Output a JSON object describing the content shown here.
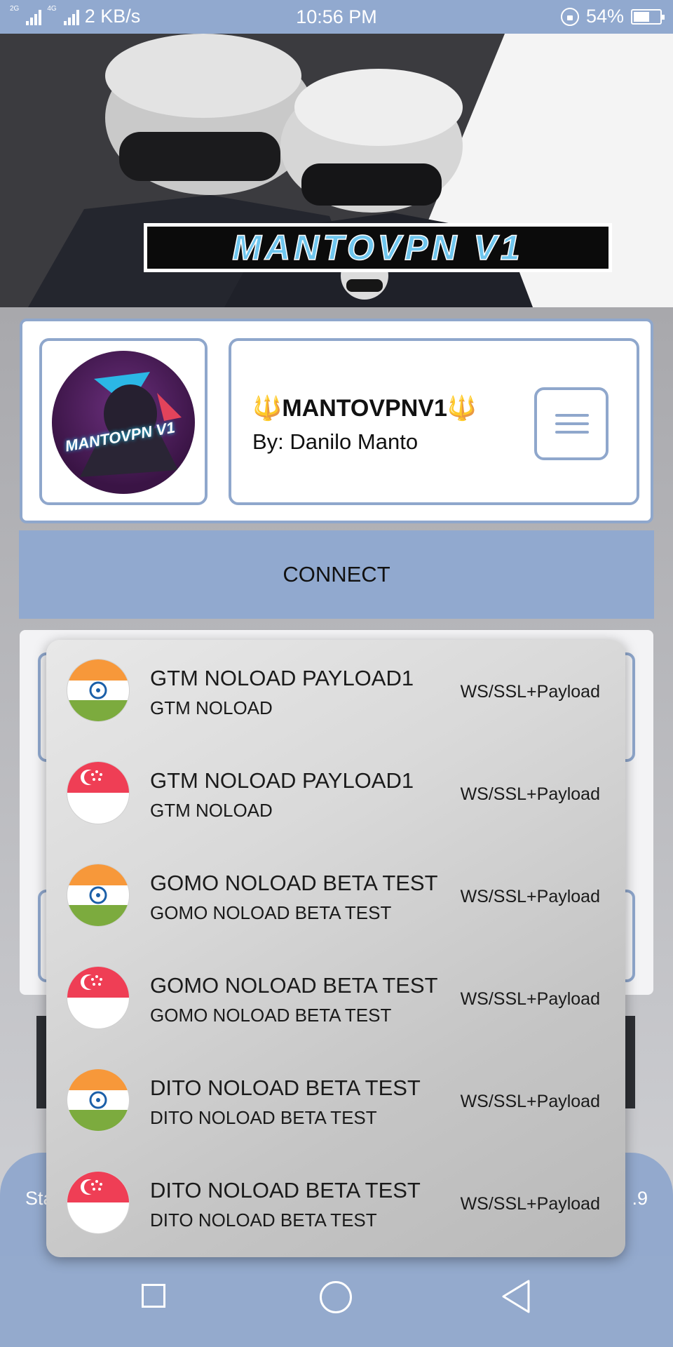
{
  "status_bar": {
    "net_a": "2G",
    "net_b": "4G",
    "speed": "2 KB/s",
    "time": "10:56 PM",
    "battery": "54%"
  },
  "banner": {
    "logo_text": "MANTOVPN V1"
  },
  "header": {
    "logo_text": "MANTOVPN V1",
    "app_name": "🔱MANTOVPNV1🔱",
    "author": "By: Danilo Manto"
  },
  "connect_label": "CONNECT",
  "bottom": {
    "left": "Sta",
    "right": ".9"
  },
  "servers": [
    {
      "flag": "india",
      "title": "GTM NOLOAD PAYLOAD1",
      "subtitle": "GTM NOLOAD",
      "type": "WS/SSL+Payload"
    },
    {
      "flag": "singapore",
      "title": "GTM NOLOAD PAYLOAD1",
      "subtitle": "GTM NOLOAD",
      "type": "WS/SSL+Payload"
    },
    {
      "flag": "india",
      "title": "GOMO NOLOAD BETA TEST",
      "subtitle": "GOMO NOLOAD BETA TEST",
      "type": "WS/SSL+Payload"
    },
    {
      "flag": "singapore",
      "title": "GOMO NOLOAD BETA TEST",
      "subtitle": "GOMO NOLOAD BETA TEST",
      "type": "WS/SSL+Payload"
    },
    {
      "flag": "india",
      "title": "DITO NOLOAD BETA TEST",
      "subtitle": "DITO NOLOAD BETA TEST",
      "type": "WS/SSL+Payload"
    },
    {
      "flag": "singapore",
      "title": "DITO NOLOAD BETA TEST",
      "subtitle": "DITO NOLOAD BETA TEST",
      "type": "WS/SSL+Payload"
    }
  ],
  "colors": {
    "accent": "#91a9cf",
    "card_border": "#8fa7cc"
  }
}
